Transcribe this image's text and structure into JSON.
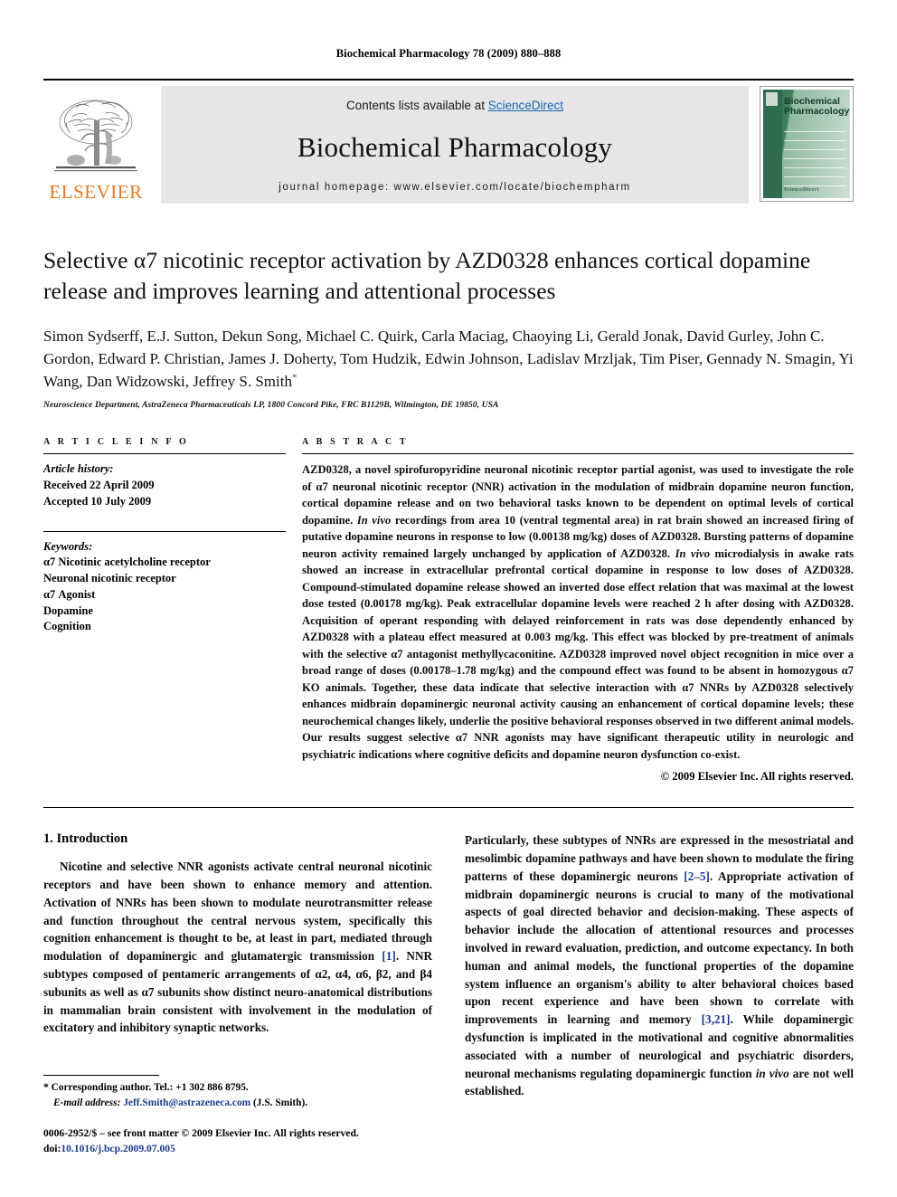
{
  "running_head": "Biochemical Pharmacology 78 (2009) 880–888",
  "masthead": {
    "contents_prefix": "Contents lists available at ",
    "sciencedirect": "ScienceDirect",
    "journal_title": "Biochemical Pharmacology",
    "homepage": "journal homepage: www.elsevier.com/locate/biochempharm",
    "publisher_logo_text": "ELSEVIER",
    "cover": {
      "title_line1": "Biochemical",
      "title_line2": "Pharmacology",
      "footer_brand": "ScienceDirect"
    }
  },
  "article": {
    "title": "Selective α7 nicotinic receptor activation by AZD0328 enhances cortical dopamine release and improves learning and attentional processes",
    "authors": "Simon Sydserff, E.J. Sutton, Dekun Song, Michael C. Quirk, Carla Maciag, Chaoying Li, Gerald Jonak, David Gurley, John C. Gordon, Edward P. Christian, James J. Doherty, Tom Hudzik, Edwin Johnson, Ladislav Mrzljak, Tim Piser, Gennady N. Smagin, Yi Wang, Dan Widzowski, Jeffrey S. Smith",
    "corresponding_marker": "*",
    "affiliation": "Neuroscience Department, AstraZeneca Pharmaceuticals LP, 1800 Concord Pike, FRC B1129B, Wilmington, DE 19850, USA"
  },
  "article_info": {
    "label": "A R T I C L E   I N F O",
    "history_label": "Article history:",
    "received": "Received 22 April 2009",
    "accepted": "Accepted 10 July 2009",
    "keywords_label": "Keywords:",
    "keywords": [
      "α7 Nicotinic acetylcholine receptor",
      "Neuronal nicotinic receptor",
      "α7 Agonist",
      "Dopamine",
      "Cognition"
    ]
  },
  "abstract": {
    "label": "A B S T R A C T",
    "p1": "AZD0328, a novel spirofuropyridine neuronal nicotinic receptor partial agonist, was used to investigate the role of α7 neuronal nicotinic receptor (NNR) activation in the modulation of midbrain dopamine neuron function, cortical dopamine release and on two behavioral tasks known to be dependent on optimal levels of cortical dopamine. ",
    "i1": "In vivo",
    "p2": " recordings from area 10 (ventral tegmental area) in rat brain showed an increased firing of putative dopamine neurons in response to low (0.00138 mg/kg) doses of AZD0328. Bursting patterns of dopamine neuron activity remained largely unchanged by application of AZD0328. ",
    "i2": "In vivo",
    "p3": " microdialysis in awake rats showed an increase in extracellular prefrontal cortical dopamine in response to low doses of AZD0328. Compound-stimulated dopamine release showed an inverted dose effect relation that was maximal at the lowest dose tested (0.00178 mg/kg). Peak extracellular dopamine levels were reached 2 h after dosing with AZD0328. Acquisition of operant responding with delayed reinforcement in rats was dose dependently enhanced by AZD0328 with a plateau effect measured at 0.003 mg/kg. This effect was blocked by pre-treatment of animals with the selective α7 antagonist methyllycaconitine. AZD0328 improved novel object recognition in mice over a broad range of doses (0.00178–1.78 mg/kg) and the compound effect was found to be absent in homozygous α7 KO animals. Together, these data indicate that selective interaction with α7 NNRs by AZD0328 selectively enhances midbrain dopaminergic neuronal activity causing an enhancement of cortical dopamine levels; these neurochemical changes likely, underlie the positive behavioral responses observed in two different animal models. Our results suggest selective α7 NNR agonists may have significant therapeutic utility in neurologic and psychiatric indications where cognitive deficits and dopamine neuron dysfunction co-exist.",
    "copyright": "© 2009 Elsevier Inc. All rights reserved."
  },
  "introduction": {
    "heading": "1. Introduction",
    "left_p1_a": "Nicotine and selective NNR agonists activate central neuronal nicotinic receptors and have been shown to enhance memory and attention. Activation of NNRs has been shown to modulate neurotransmitter release and function throughout the central nervous system, specifically this cognition enhancement is thought to be, at least in part, mediated through modulation of dopaminergic and glutamatergic transmission ",
    "left_ref1": "[1]",
    "left_p1_b": ". NNR subtypes composed of pentameric arrangements of α2, α4, α6, β2, and β4 subunits as well as α7 subunits show distinct neuro-anatomical distributions in mammalian brain consistent with involvement in the modulation of excitatory and inhibitory synaptic networks.",
    "right_p1_a": "Particularly, these subtypes of NNRs are expressed in the mesostriatal and mesolimbic dopamine pathways and have been shown to modulate the firing patterns of these dopaminergic neurons ",
    "right_ref1": "[2–5]",
    "right_p1_b": ". Appropriate activation of midbrain dopaminergic neurons is crucial to many of the motivational aspects of goal directed behavior and decision-making. These aspects of behavior include the allocation of attentional resources and processes involved in reward evaluation, prediction, and outcome expectancy. In both human and animal models, the functional properties of the dopamine system influence an organism's ability to alter behavioral choices based upon recent experience and have been shown to correlate with improvements in learning and memory ",
    "right_ref2": "[3,21]",
    "right_p1_c": ". While dopaminergic dysfunction is implicated in the motivational and cognitive abnormalities associated with a number of neurological and psychiatric disorders, neuronal mechanisms regulating dopaminergic function ",
    "right_ital": "in vivo",
    "right_p1_d": " are not well established."
  },
  "footnotes": {
    "corresponding_marker": "*",
    "corresponding": "Corresponding author. Tel.: +1 302 886 8795.",
    "email_label": "E-mail address:",
    "email": "Jeff.Smith@astrazeneca.com",
    "email_attrib": "(J.S. Smith).",
    "issn_line": "0006-2952/$ – see front matter © 2009 Elsevier Inc. All rights reserved.",
    "doi_prefix": "doi:",
    "doi": "10.1016/j.bcp.2009.07.005"
  },
  "colors": {
    "elsevier_orange": "#E87722",
    "link_blue": "#1b64b4",
    "ref_blue": "#1b3a8c",
    "cover_green": "#2f6b4f"
  }
}
